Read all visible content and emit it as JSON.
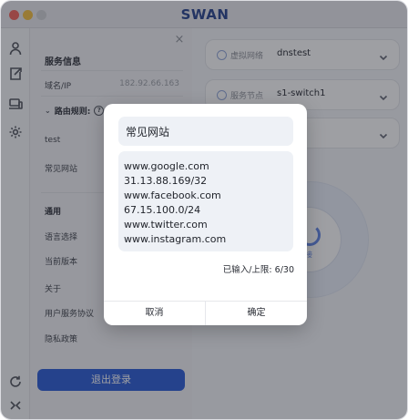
{
  "app": {
    "title": "SWAN"
  },
  "rail": {
    "icons": [
      "user-icon",
      "export-icon",
      "devices-icon",
      "settings-gear-icon",
      "refresh-icon",
      "collapse-icon"
    ]
  },
  "settings": {
    "close_glyph": "×",
    "service_info_title": "服务信息",
    "domain_label": "域名/IP",
    "domain_value": "182.92.66.163",
    "route_rules_title": "路由规则:",
    "rule_items": [
      "test",
      "常见网站"
    ],
    "general_title": "通用",
    "general_items": [
      "语言选择",
      "当前版本",
      "关于",
      "用户服务协议",
      "隐私政策"
    ],
    "logout_label": "退出登录"
  },
  "main": {
    "virtual_network_label": "虚拟网络",
    "virtual_network_value": "dnstest",
    "service_node_label": "服务节点",
    "service_node_value": "s1-switch1",
    "connect_caption": "接"
  },
  "modal": {
    "title": "常见网站",
    "entries": [
      "www.google.com",
      "31.13.88.169/32",
      "www.facebook.com",
      "67.15.100.0/24",
      "www.twitter.com",
      "www.instagram.com"
    ],
    "counter": "已输入/上限: 6/30",
    "cancel_label": "取消",
    "confirm_label": "确定"
  },
  "colors": {
    "accent": "#2456d6",
    "title": "#1f3c8a",
    "overlay": "rgba(40,42,50,0.45)"
  }
}
